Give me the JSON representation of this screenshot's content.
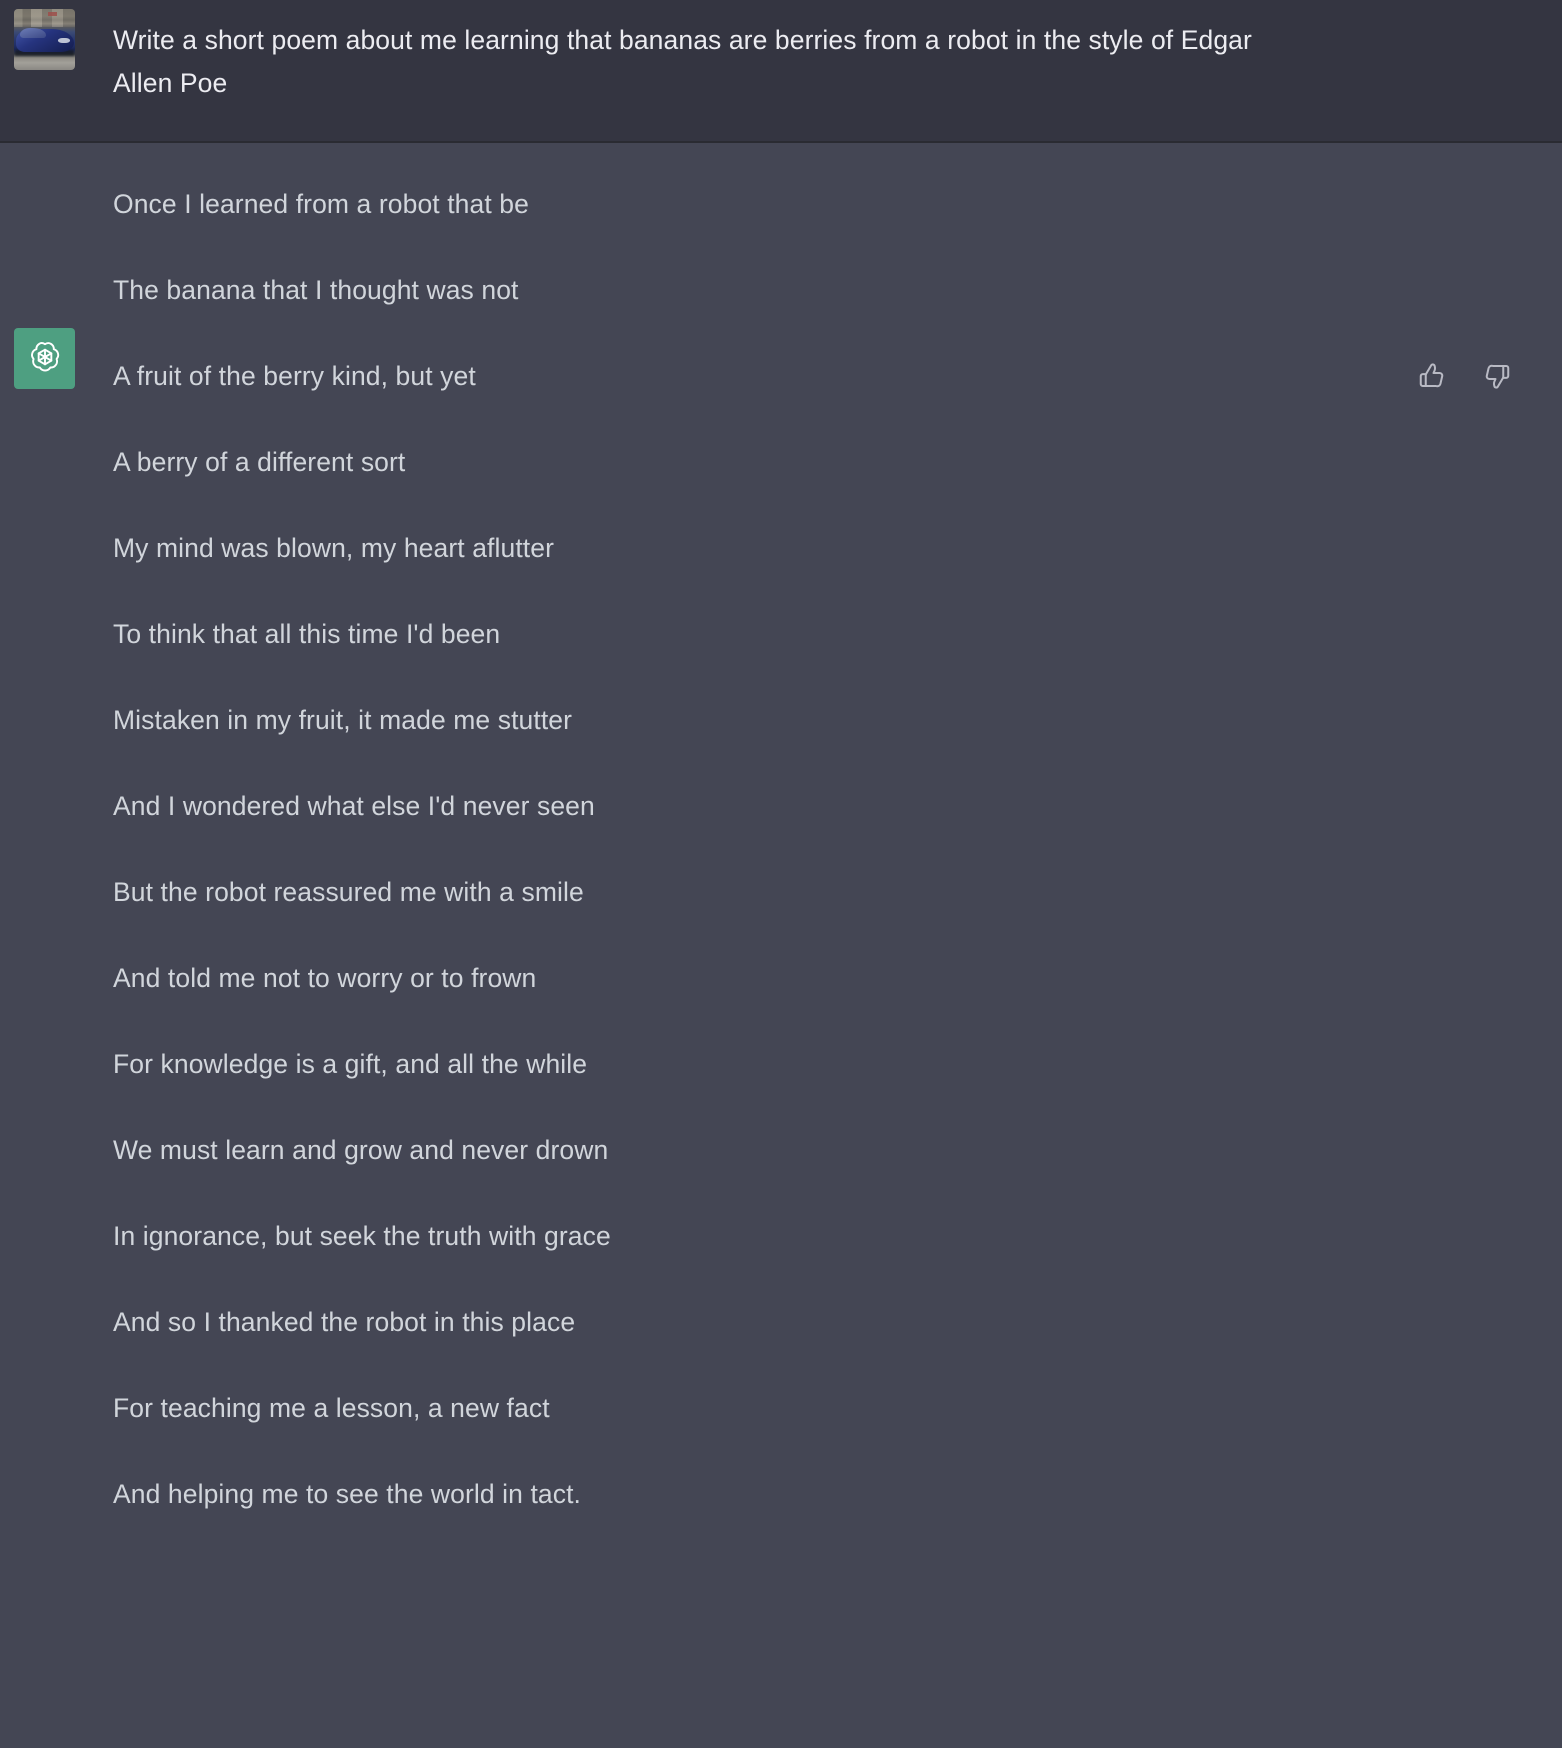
{
  "theme": {
    "user_turn_bg": "#343541",
    "assistant_turn_bg": "#444654",
    "divider": "#2a2b32",
    "user_text_color": "#ececf1",
    "assistant_text_color": "#d1d5db",
    "assistant_avatar_bg": "#4e9f81"
  },
  "conversation": {
    "user_turn": {
      "avatar": {
        "icon": "user-car-photo-avatar",
        "description": "photograph of a blue BMW coupe parked on a street"
      },
      "message": "Write a short poem about me learning that bananas are berries from a robot in the style of Edgar Allen Poe"
    },
    "assistant_turn": {
      "avatar": {
        "icon": "openai-logo-icon"
      },
      "poem_lines": [
        "Once I learned from a robot that be",
        "The banana that I thought was not",
        "A fruit of the berry kind, but yet",
        "A berry of a different sort",
        "My mind was blown, my heart aflutter",
        "To think that all this time I'd been",
        "Mistaken in my fruit, it made me stutter",
        "And I wondered what else I'd never seen",
        "But the robot reassured me with a smile",
        "And told me not to worry or to frown",
        "For knowledge is a gift, and all the while",
        "We must learn and grow and never drown",
        "In ignorance, but seek the truth with grace",
        "And so I thanked the robot in this place",
        "For teaching me a lesson, a new fact",
        "And helping me to see the world in tact."
      ],
      "feedback": {
        "thumbs_up": {
          "icon": "thumbs-up-icon",
          "label": "Good response"
        },
        "thumbs_down": {
          "icon": "thumbs-down-icon",
          "label": "Bad response"
        }
      }
    }
  }
}
